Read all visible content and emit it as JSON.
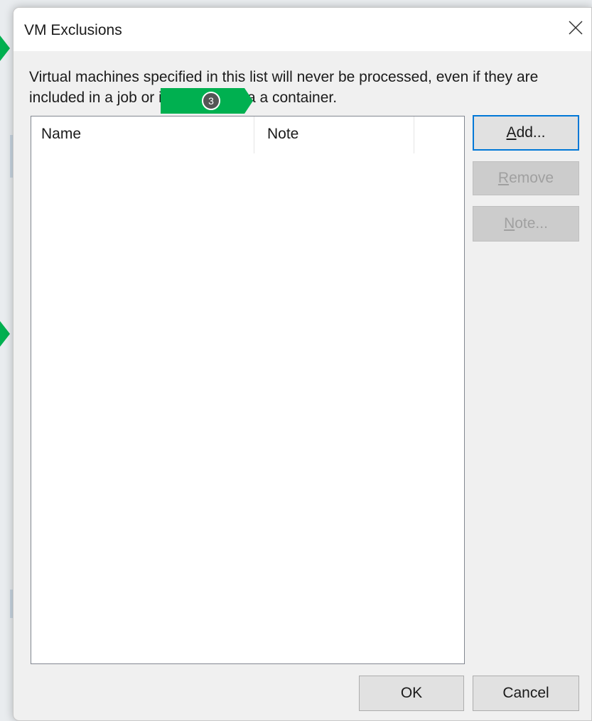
{
  "dialog": {
    "title": "VM Exclusions",
    "description": "Virtual machines specified in this list will never be processed, even if they are included in a job or implicitly or via a container.",
    "callout_number": "3"
  },
  "list": {
    "columns": [
      {
        "label": "Name"
      },
      {
        "label": "Note"
      }
    ],
    "rows": []
  },
  "side_buttons": {
    "add": {
      "mnemonic": "A",
      "rest": "dd...",
      "enabled": true
    },
    "remove": {
      "mnemonic": "R",
      "rest": "emove",
      "enabled": false
    },
    "note": {
      "mnemonic": "N",
      "rest": "ote...",
      "enabled": false
    }
  },
  "footer": {
    "ok_label": "OK",
    "cancel_label": "Cancel"
  },
  "icons": {
    "close": "close-icon",
    "callout_arrow": "arrow-right-icon"
  },
  "colors": {
    "callout_green": "#00b050",
    "focus_blue": "#0078d7",
    "badge_gray": "#555555"
  }
}
